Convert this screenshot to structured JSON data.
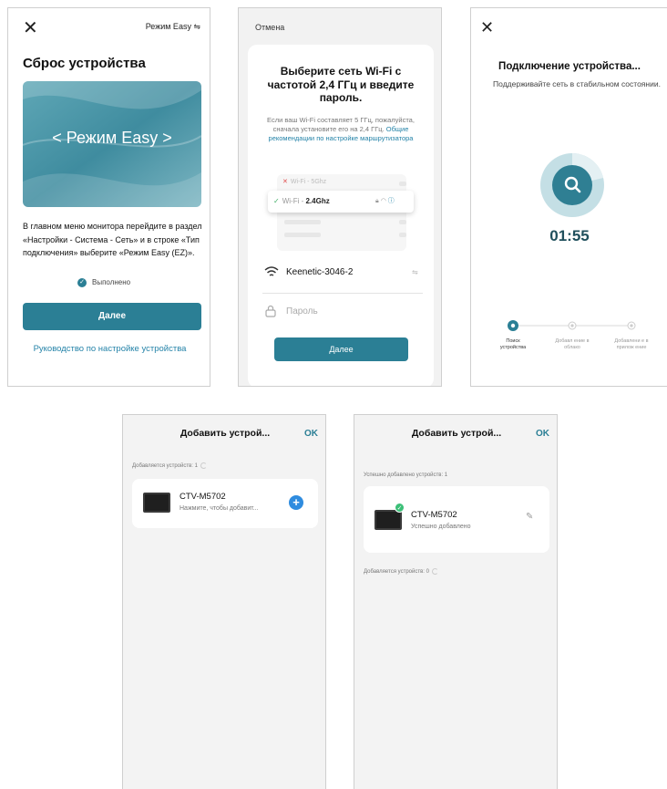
{
  "screen_reset": {
    "close_icon": "✕",
    "mode_label": "Режим Easy ⇋",
    "title": "Сброс устройства",
    "hero_text": "< Режим Easy >",
    "description": "В главном меню монитора перейдите в раздел «Настройки - Система - Сеть» и в строке «Тип подключения» выберите «Режим Easy (EZ)».",
    "done_label": "Выполнено",
    "next_button": "Далее",
    "guide_link": "Руководство по настройке устройства",
    "accent_color": "#2b7f95"
  },
  "screen_wifi": {
    "cancel_label": "Отмена",
    "title": "Выберите сеть Wi-Fi с частотой 2,4 ГГц и введите пароль.",
    "hint_text": "Если ваш Wi-Fi составляет 5 ГГц, пожалуйста, сначала установите его на 2,4 ГГц.",
    "hint_link": "Общие рекомендации по настройке маршрутизатора",
    "illus_5g_prefix": "Wi-Fi - ",
    "illus_5g_name": "5Ghz",
    "illus_24_prefix": "Wi-Fi - ",
    "illus_24_name": "2.4Ghz",
    "network_name": "Keenetic-3046-2",
    "password_placeholder": "Пароль",
    "next_button": "Далее"
  },
  "screen_connect": {
    "close_icon": "✕",
    "title": "Подключение устройства...",
    "subtitle": "Поддерживайте сеть в стабильном состоянии.",
    "timer": "01:55",
    "steps": [
      {
        "label": "Поиск устройства",
        "active": true
      },
      {
        "label": "Добавл ение в облако",
        "active": false
      },
      {
        "label": "Добавлени е в прилож ение",
        "active": false
      }
    ]
  },
  "screen_add": {
    "title": "Добавить устрой...",
    "ok_label": "OK",
    "adding_label": "Добавляется устройств: 1",
    "device_name": "CTV-M5702",
    "device_hint": "Нажмите, чтобы добавит..."
  },
  "screen_added": {
    "title": "Добавить устрой...",
    "ok_label": "OK",
    "success_label": "Успешно добавлено устройств: 1",
    "device_name": "CTV-M5702",
    "device_status": "Успешно добавлено",
    "adding_label": "Добавляется устройств: 0"
  }
}
